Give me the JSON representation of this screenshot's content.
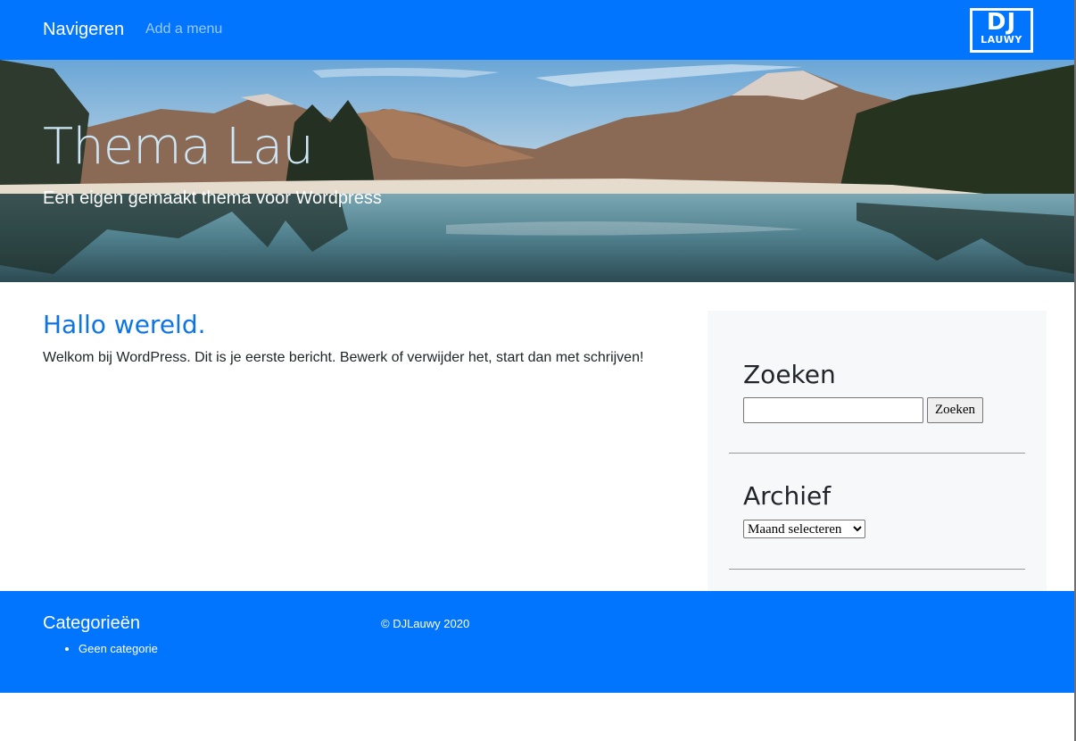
{
  "navbar": {
    "brand": "Navigeren",
    "menu_link": "Add a menu",
    "logo_top": "DJ",
    "logo_bottom": "LAUWY"
  },
  "hero": {
    "title": "Thema Lau",
    "subtitle": "Een eigen gemaakt thema voor Wordpress"
  },
  "post": {
    "title": "Hallo wereld.",
    "body": "Welkom bij WordPress. Dit is je eerste bericht. Bewerk of verwijder het, start dan met schrijven!"
  },
  "sidebar": {
    "search_title": "Zoeken",
    "search_value": "",
    "search_button": "Zoeken",
    "archive_title": "Archief",
    "archive_selected": "Maand selecteren"
  },
  "footer": {
    "categories_title": "Categorieën",
    "categories": [
      "Geen categorie"
    ],
    "copyright": "© DJLauwy 2020"
  },
  "colors": {
    "primary": "#0275ff",
    "link": "#0d74e6",
    "sidebar_bg": "#f7f8f9"
  },
  "icons": {
    "logo": "dj-lauwy-logo",
    "dropdown": "chevron-down-icon"
  }
}
